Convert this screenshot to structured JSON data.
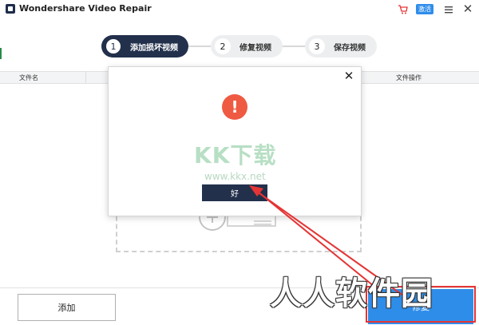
{
  "app": {
    "title": "Wondershare Video Repair",
    "activate_label": "激活"
  },
  "steps": [
    {
      "num": "1",
      "label": "添加损坏视频"
    },
    {
      "num": "2",
      "label": "修复视频"
    },
    {
      "num": "3",
      "label": "保存视频"
    }
  ],
  "table": {
    "col_filename": "文件名",
    "col_actions": "文件操作"
  },
  "dialog": {
    "ok_label": "好"
  },
  "bottom": {
    "add_label": "添加",
    "repair_label": "修复"
  },
  "watermarks": {
    "kk": "KK下载",
    "kk_url": "www.kkx.net",
    "site": "人人软件园"
  },
  "colors": {
    "accent": "#2f8dea",
    "navy": "#22304b",
    "alert": "#ef5a42",
    "annotation": "#e53434"
  },
  "icons": [
    "app-logo-icon",
    "cart-icon",
    "menu-icon",
    "close-icon",
    "alert-icon",
    "add-plus-icon"
  ]
}
